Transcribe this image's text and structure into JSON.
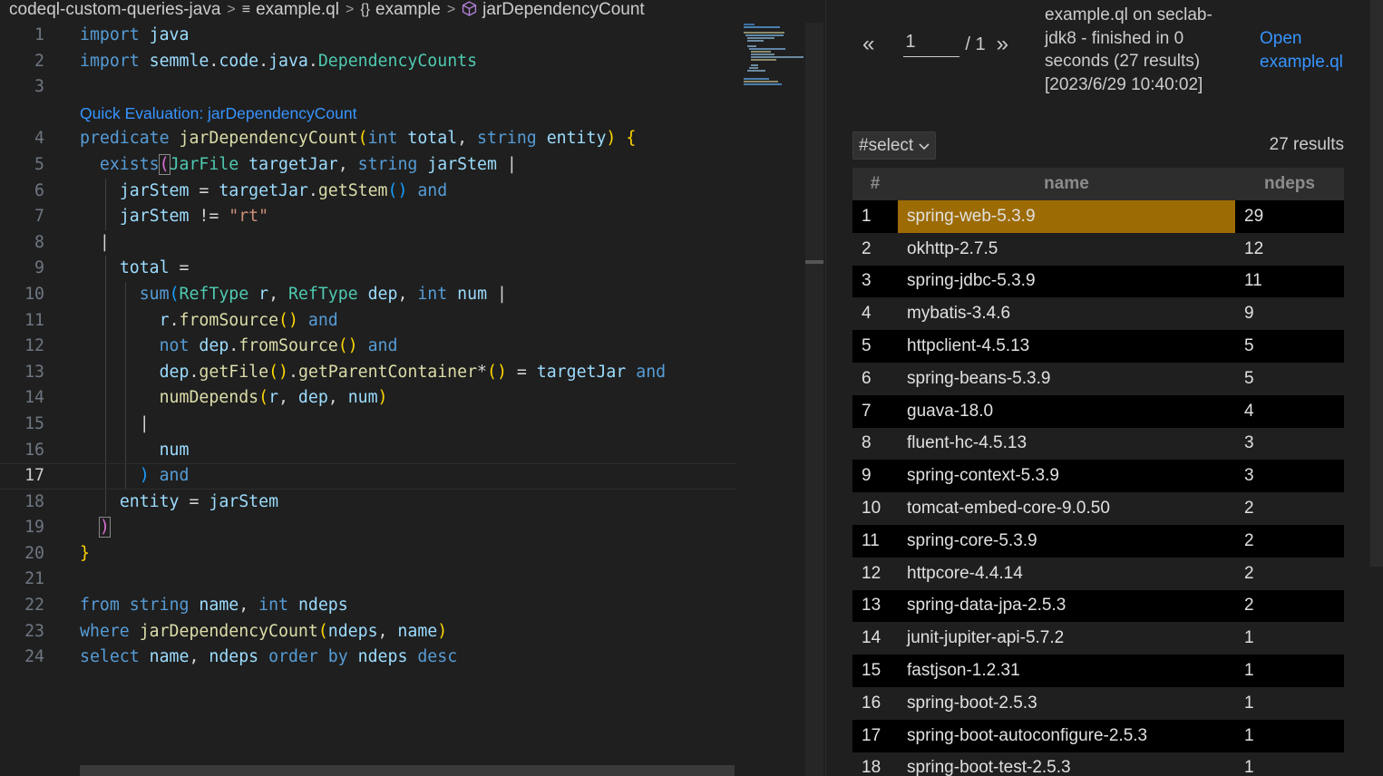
{
  "breadcrumb": {
    "project": "codeql-custom-queries-java",
    "file": "example.ql",
    "module": "example",
    "symbol": "jarDependencyCount"
  },
  "code_lens": "Quick Evaluation: jarDependencyCount",
  "code_lines": [
    {
      "n": 1,
      "tokens": [
        [
          "kw",
          "import"
        ],
        [
          "",
          ""
        ],
        [
          "va",
          "java"
        ]
      ]
    },
    {
      "n": 2,
      "tokens": [
        [
          "kw",
          "import"
        ],
        [
          "",
          ""
        ],
        [
          "va",
          "semmle"
        ],
        [
          "op",
          "."
        ],
        [
          "va",
          "code"
        ],
        [
          "op",
          "."
        ],
        [
          "va",
          "java"
        ],
        [
          "op",
          "."
        ],
        [
          "ty",
          "DependencyCounts"
        ]
      ]
    }
  ],
  "current_line": 17,
  "results": {
    "pager": {
      "prev": "«",
      "next": "»",
      "page": "1",
      "total": "/ 1"
    },
    "status": "example.ql on seclab-jdk8 - finished in 0 seconds (27 results) [2023/6/29 10:40:02]",
    "open_link": "Open example.ql",
    "select_label": "#select",
    "count_label": "27 results",
    "columns": [
      "#",
      "name",
      "ndeps"
    ],
    "rows": [
      [
        "1",
        "spring-web-5.3.9",
        "29"
      ],
      [
        "2",
        "okhttp-2.7.5",
        "12"
      ],
      [
        "3",
        "spring-jdbc-5.3.9",
        "11"
      ],
      [
        "4",
        "mybatis-3.4.6",
        "9"
      ],
      [
        "5",
        "httpclient-4.5.13",
        "5"
      ],
      [
        "6",
        "spring-beans-5.3.9",
        "5"
      ],
      [
        "7",
        "guava-18.0",
        "4"
      ],
      [
        "8",
        "fluent-hc-4.5.13",
        "3"
      ],
      [
        "9",
        "spring-context-5.3.9",
        "3"
      ],
      [
        "10",
        "tomcat-embed-core-9.0.50",
        "2"
      ],
      [
        "11",
        "spring-core-5.3.9",
        "2"
      ],
      [
        "12",
        "httpcore-4.4.14",
        "2"
      ],
      [
        "13",
        "spring-data-jpa-2.5.3",
        "2"
      ],
      [
        "14",
        "junit-jupiter-api-5.7.2",
        "1"
      ],
      [
        "15",
        "fastjson-1.2.31",
        "1"
      ],
      [
        "16",
        "spring-boot-2.5.3",
        "1"
      ],
      [
        "17",
        "spring-boot-autoconfigure-2.5.3",
        "1"
      ],
      [
        "18",
        "spring-boot-test-2.5.3",
        "1"
      ]
    ],
    "selected_row": 0
  }
}
